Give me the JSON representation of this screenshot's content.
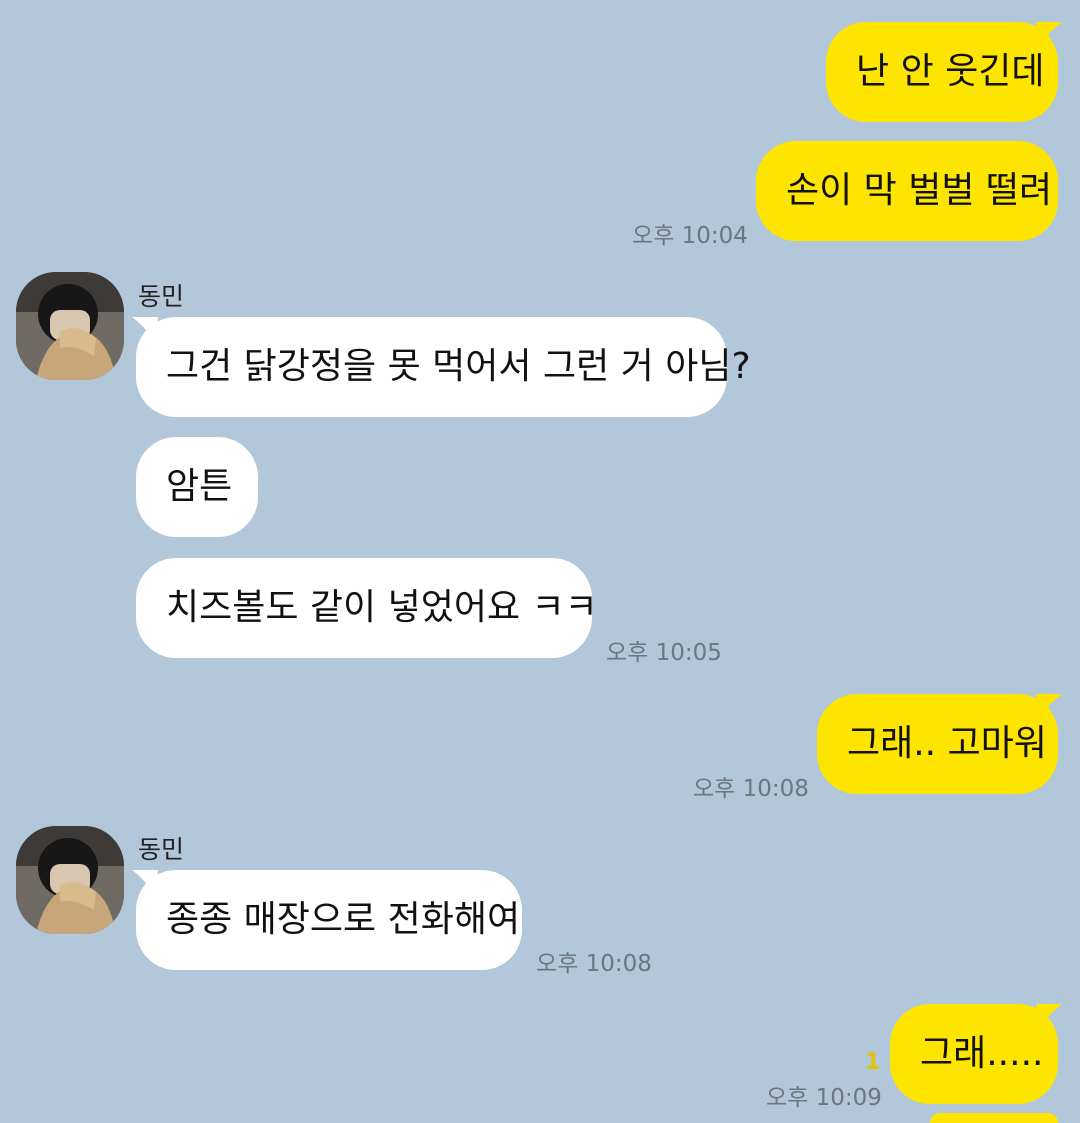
{
  "messages": [
    {
      "id": "m1",
      "sender": "me",
      "text": "난 안 웃긴데"
    },
    {
      "id": "m2",
      "sender": "me",
      "text": "손이 막 벌벌 떨려",
      "time": "오후 10:04"
    },
    {
      "id": "m3",
      "sender": "동민",
      "text": "그건 닭강정을 못 먹어서 그런 거 아님?"
    },
    {
      "id": "m4",
      "sender": "동민",
      "text": "암튼"
    },
    {
      "id": "m5",
      "sender": "동민",
      "text": "치즈볼도 같이 넣었어요 ㅋㅋ",
      "time": "오후 10:05"
    },
    {
      "id": "m6",
      "sender": "me",
      "text": "그래.. 고마워",
      "time": "오후 10:08"
    },
    {
      "id": "m7",
      "sender": "동민",
      "text": "종종 매장으로 전화해여",
      "time": "오후 10:08"
    },
    {
      "id": "m8",
      "sender": "me",
      "text": "그래.....",
      "time": "오후 10:09",
      "unread": "1"
    }
  ],
  "participant": {
    "name": "동민"
  },
  "colors": {
    "background": "#b2c7da",
    "my_bubble": "#fee500",
    "other_bubble": "#ffffff",
    "unread": "#e3c400"
  }
}
